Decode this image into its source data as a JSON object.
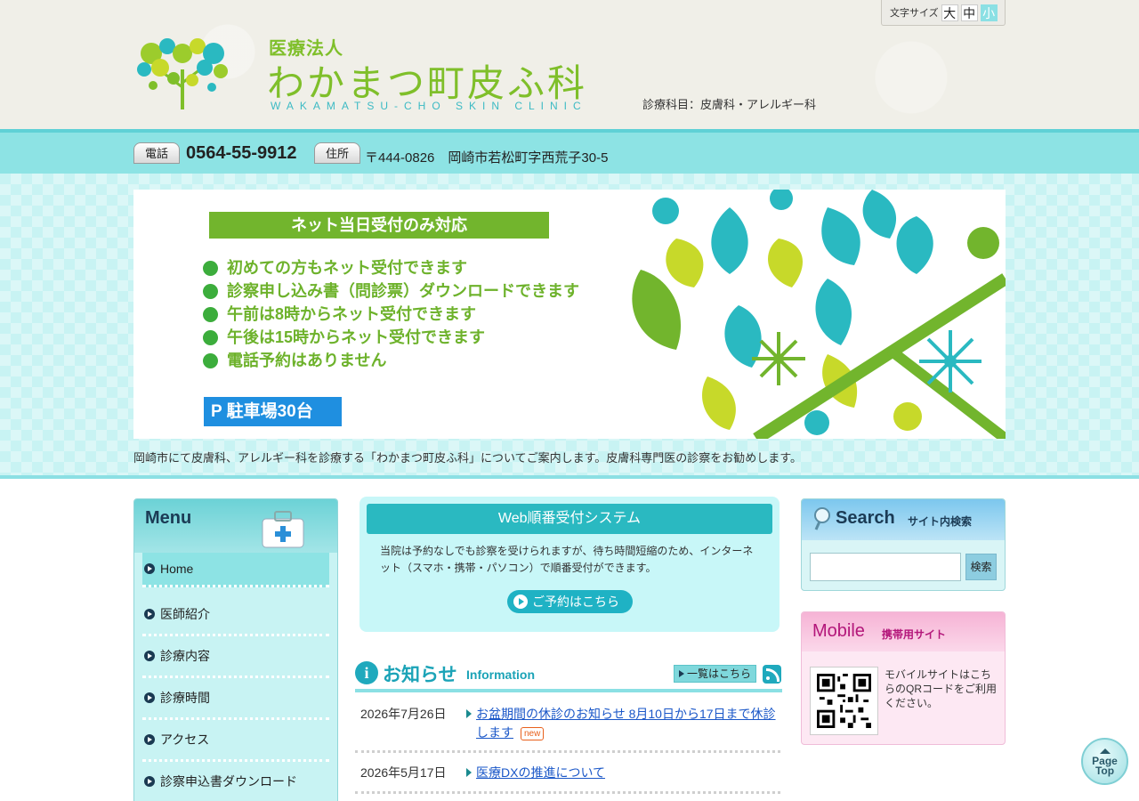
{
  "header": {
    "font_size_label": "文字サイズ",
    "font_sizes": [
      "大",
      "中",
      "小"
    ],
    "logo_corp": "医療法人",
    "logo_name": "わかまつ町皮ふ科",
    "logo_roman": "WAKAMATSU-CHO SKIN CLINIC",
    "departments": "診療科目：皮膚科・アレルギー科"
  },
  "contact": {
    "phone_tag": "電話",
    "phone": "0564-55-9912",
    "address_tag": "住所",
    "address": "〒444-0826　岡崎市若松町字西荒子30-5"
  },
  "banner": {
    "title": "ネット当日受付のみ対応",
    "items": [
      "初めての方もネット受付できます",
      "診察申し込み書（問診票）ダウンロードできます",
      "午前は8時からネット受付できます",
      "午後は15時からネット受付できます",
      "電話予約はありません"
    ],
    "parking": "P 駐車場30台"
  },
  "intro": "岡崎市にて皮膚科、アレルギー科を診療する「わかまつ町皮ふ科」についてご案内します。皮膚科専門医の診察をお勧めします。",
  "menu": {
    "title": "Menu",
    "items": [
      {
        "label": "Home"
      },
      {
        "label": "医師紹介"
      },
      {
        "label": "診療内容"
      },
      {
        "label": "診療時間"
      },
      {
        "label": "アクセス"
      },
      {
        "label": "診察申込書ダウンロード"
      }
    ]
  },
  "reserve": {
    "title": "Web順番受付システム",
    "text": "当院は予約なしでも診察を受けられますが、待ち時間短縮のため、インターネット（スマホ・携帯・パソコン）で順番受付ができます。",
    "button": "ご予約はこちら"
  },
  "news": {
    "title": "お知らせ",
    "title_en": "Information",
    "list_link": "一覧はこちら",
    "items": [
      {
        "date": "2026年7月26日",
        "text": "お盆期間の休診のお知らせ 8月10日から17日まで休診します",
        "badge": "new"
      },
      {
        "date": "2026年5月17日",
        "text": "医療DXの推進について",
        "badge": ""
      }
    ]
  },
  "search": {
    "title": "Search",
    "subtitle": "サイト内検索",
    "placeholder": "",
    "button": "検索"
  },
  "mobile": {
    "title": "Mobile",
    "subtitle": "携帯用サイト",
    "text": "モバイルサイトはこちらのQRコードをご利用ください。"
  },
  "page_top": {
    "line1": "Page",
    "line2": "Top"
  },
  "colors": {
    "accent": "#8de3e4",
    "brand_green": "#7fbf2a",
    "brand_teal": "#1fb2c4",
    "link": "#1a57c8",
    "new_badge": "#e8601c"
  }
}
